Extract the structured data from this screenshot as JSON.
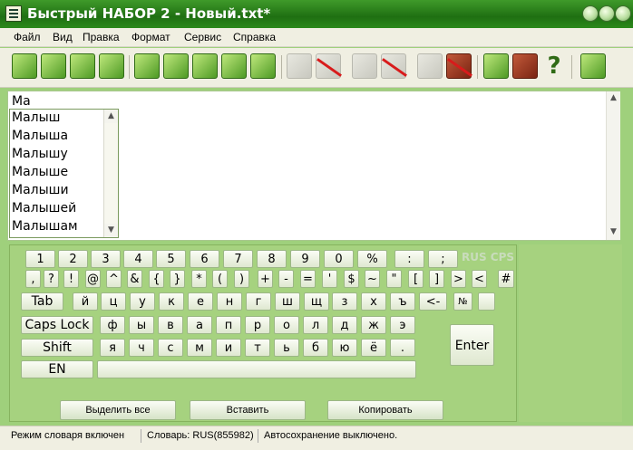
{
  "window": {
    "title": "Быстрый НАБОР 2 - Новый.txt*"
  },
  "menu": [
    "Файл",
    "Вид",
    "Правка",
    "Формат",
    "Сервис",
    "Справка"
  ],
  "editor": {
    "text": "Ма",
    "suggestions": [
      "Малыш",
      "Малыша",
      "Малышу",
      "Малыше",
      "Малыши",
      "Малышей",
      "Малышам"
    ]
  },
  "keyboard": {
    "row1": [
      "1",
      "2",
      "3",
      "4",
      "5",
      "6",
      "7",
      "8",
      "9",
      "0",
      "%",
      ":",
      ";"
    ],
    "row2": [
      ",",
      "?",
      "!",
      "@",
      "^",
      "&",
      "{",
      "}",
      "*",
      "(",
      ")",
      "+",
      "-",
      "=",
      "'",
      "$",
      "~",
      "\"",
      "[",
      "]",
      ">",
      "<",
      "#"
    ],
    "row3": [
      "Tab",
      "й",
      "ц",
      "у",
      "к",
      "е",
      "н",
      "г",
      "ш",
      "щ",
      "з",
      "х",
      "ъ",
      "<-",
      "№"
    ],
    "row4": [
      "Caps Lock",
      "ф",
      "ы",
      "в",
      "а",
      "п",
      "р",
      "о",
      "л",
      "д",
      "ж",
      "э"
    ],
    "row5": [
      "Shift",
      "я",
      "ч",
      "с",
      "м",
      "и",
      "т",
      "ь",
      "б",
      "ю",
      "ё",
      "."
    ],
    "lang": "EN",
    "enter": "Enter",
    "indicator": "RUS CPS",
    "buttons": {
      "select_all": "Выделить все",
      "paste": "Вставить",
      "copy": "Копировать"
    }
  },
  "status": {
    "mode": "Режим словаря включен",
    "dictionary": "Словарь: RUS(855982)",
    "autosave": "Автосохранение выключено."
  }
}
